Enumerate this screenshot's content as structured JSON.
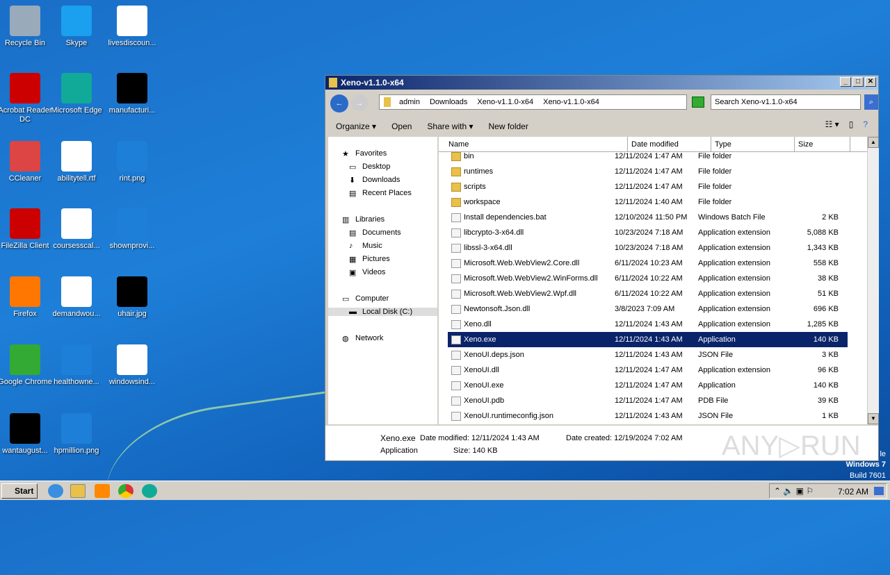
{
  "desktop": {
    "icons": [
      {
        "label": "Recycle Bin",
        "color": "#9ab"
      },
      {
        "label": "Skype",
        "color": "#1aa0ee"
      },
      {
        "label": "livesdiscoun...",
        "color": "#fff"
      },
      {
        "label": "Acrobat Reader DC",
        "color": "#c00"
      },
      {
        "label": "Microsoft Edge",
        "color": "#1a9"
      },
      {
        "label": "manufacturi...",
        "color": "#000"
      },
      {
        "label": "CCleaner",
        "color": "#d44"
      },
      {
        "label": "abilitytell.rtf",
        "color": "#fff"
      },
      {
        "label": "rint.png",
        "color": "#1e7fd8"
      },
      {
        "label": "FileZilla Client",
        "color": "#c00"
      },
      {
        "label": "coursesscal...",
        "color": "#fff"
      },
      {
        "label": "shownprovi...",
        "color": "#1e7fd8"
      },
      {
        "label": "Firefox",
        "color": "#f70"
      },
      {
        "label": "demandwou...",
        "color": "#fff"
      },
      {
        "label": "uhair.jpg",
        "color": "#000"
      },
      {
        "label": "Google Chrome",
        "color": "#3a3"
      },
      {
        "label": "healthowne...",
        "color": "#1e7fd8"
      },
      {
        "label": "windowsind...",
        "color": "#fff"
      },
      {
        "label": "wantaugust...",
        "color": "#000"
      },
      {
        "label": "hpmillion.png",
        "color": "#1e7fd8"
      }
    ]
  },
  "window": {
    "title": "Xeno-v1.1.0-x64",
    "breadcrumb": [
      "admin",
      "Downloads",
      "Xeno-v1.1.0-x64",
      "Xeno-v1.1.0-x64"
    ],
    "search_placeholder": "Search Xeno-v1.1.0-x64",
    "toolbar": {
      "organize": "Organize ▾",
      "open": "Open",
      "share": "Share with ▾",
      "new_folder": "New folder"
    },
    "nav": [
      {
        "label": "Favorites",
        "icon": "★"
      },
      {
        "label": "Desktop",
        "icon": "▭"
      },
      {
        "label": "Downloads",
        "icon": "⬇"
      },
      {
        "label": "Recent Places",
        "icon": "▤"
      },
      {
        "label": "Libraries",
        "icon": "▥"
      },
      {
        "label": "Documents",
        "icon": "▤"
      },
      {
        "label": "Music",
        "icon": "♪"
      },
      {
        "label": "Pictures",
        "icon": "▦"
      },
      {
        "label": "Videos",
        "icon": "▣"
      },
      {
        "label": "Computer",
        "icon": "▭"
      },
      {
        "label": "Local Disk (C:)",
        "icon": "▬"
      },
      {
        "label": "Network",
        "icon": "◍"
      }
    ],
    "columns": [
      "Name",
      "Date modified",
      "Type",
      "Size"
    ],
    "files": [
      {
        "name": "bin",
        "date": "12/11/2024 1:47 AM",
        "type": "File folder",
        "size": "",
        "folder": true
      },
      {
        "name": "runtimes",
        "date": "12/11/2024 1:47 AM",
        "type": "File folder",
        "size": "",
        "folder": true
      },
      {
        "name": "scripts",
        "date": "12/11/2024 1:47 AM",
        "type": "File folder",
        "size": "",
        "folder": true
      },
      {
        "name": "workspace",
        "date": "12/11/2024 1:40 AM",
        "type": "File folder",
        "size": "",
        "folder": true
      },
      {
        "name": "Install dependencies.bat",
        "date": "12/10/2024 11:50 PM",
        "type": "Windows Batch File",
        "size": "2 KB"
      },
      {
        "name": "libcrypto-3-x64.dll",
        "date": "10/23/2024 7:18 AM",
        "type": "Application extension",
        "size": "5,088 KB"
      },
      {
        "name": "libssl-3-x64.dll",
        "date": "10/23/2024 7:18 AM",
        "type": "Application extension",
        "size": "1,343 KB"
      },
      {
        "name": "Microsoft.Web.WebView2.Core.dll",
        "date": "6/11/2024 10:23 AM",
        "type": "Application extension",
        "size": "558 KB"
      },
      {
        "name": "Microsoft.Web.WebView2.WinForms.dll",
        "date": "6/11/2024 10:22 AM",
        "type": "Application extension",
        "size": "38 KB"
      },
      {
        "name": "Microsoft.Web.WebView2.Wpf.dll",
        "date": "6/11/2024 10:22 AM",
        "type": "Application extension",
        "size": "51 KB"
      },
      {
        "name": "Newtonsoft.Json.dll",
        "date": "3/8/2023 7:09 AM",
        "type": "Application extension",
        "size": "696 KB"
      },
      {
        "name": "Xeno.dll",
        "date": "12/11/2024 1:43 AM",
        "type": "Application extension",
        "size": "1,285 KB"
      },
      {
        "name": "Xeno.exe",
        "date": "12/11/2024 1:43 AM",
        "type": "Application",
        "size": "140 KB",
        "selected": true
      },
      {
        "name": "XenoUI.deps.json",
        "date": "12/11/2024 1:43 AM",
        "type": "JSON File",
        "size": "3 KB"
      },
      {
        "name": "XenoUI.dll",
        "date": "12/11/2024 1:47 AM",
        "type": "Application extension",
        "size": "96 KB"
      },
      {
        "name": "XenoUI.exe",
        "date": "12/11/2024 1:47 AM",
        "type": "Application",
        "size": "140 KB"
      },
      {
        "name": "XenoUI.pdb",
        "date": "12/11/2024 1:47 AM",
        "type": "PDB File",
        "size": "39 KB"
      },
      {
        "name": "XenoUI.runtimeconfig.json",
        "date": "12/11/2024 1:43 AM",
        "type": "JSON File",
        "size": "1 KB"
      }
    ],
    "status": {
      "name": "Xeno.exe",
      "modified": "Date modified: 12/11/2024 1:43 AM",
      "created": "Date created: 12/19/2024 7:02 AM",
      "type": "Application",
      "size": "Size: 140 KB"
    }
  },
  "watermark": {
    "line1": "le",
    "line2": "Windows 7",
    "line3": "Build 7601",
    "logo": "ANY RUN"
  },
  "taskbar": {
    "start": "Start",
    "clock": "7:02 AM"
  }
}
